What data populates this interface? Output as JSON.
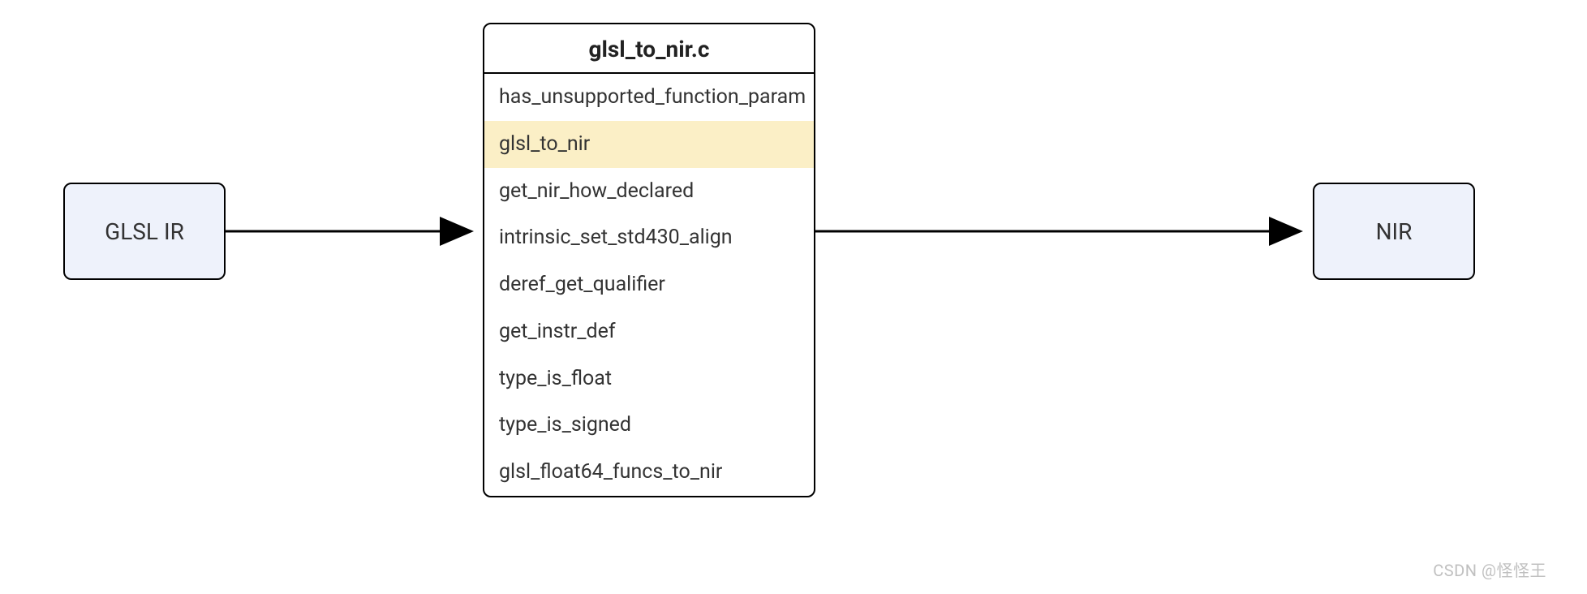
{
  "left": {
    "label": "GLSL IR"
  },
  "right": {
    "label": "NIR"
  },
  "center": {
    "title": "glsl_to_nir.c",
    "items": [
      {
        "label": "has_unsupported_function_param",
        "highlight": false
      },
      {
        "label": "glsl_to_nir",
        "highlight": true
      },
      {
        "label": "get_nir_how_declared",
        "highlight": false
      },
      {
        "label": "intrinsic_set_std430_align",
        "highlight": false
      },
      {
        "label": "deref_get_qualifier",
        "highlight": false
      },
      {
        "label": "get_instr_def",
        "highlight": false
      },
      {
        "label": "type_is_float",
        "highlight": false
      },
      {
        "label": "type_is_signed",
        "highlight": false
      },
      {
        "label": "glsl_float64_funcs_to_nir",
        "highlight": false
      }
    ]
  },
  "watermark": "CSDN @怪怪王"
}
